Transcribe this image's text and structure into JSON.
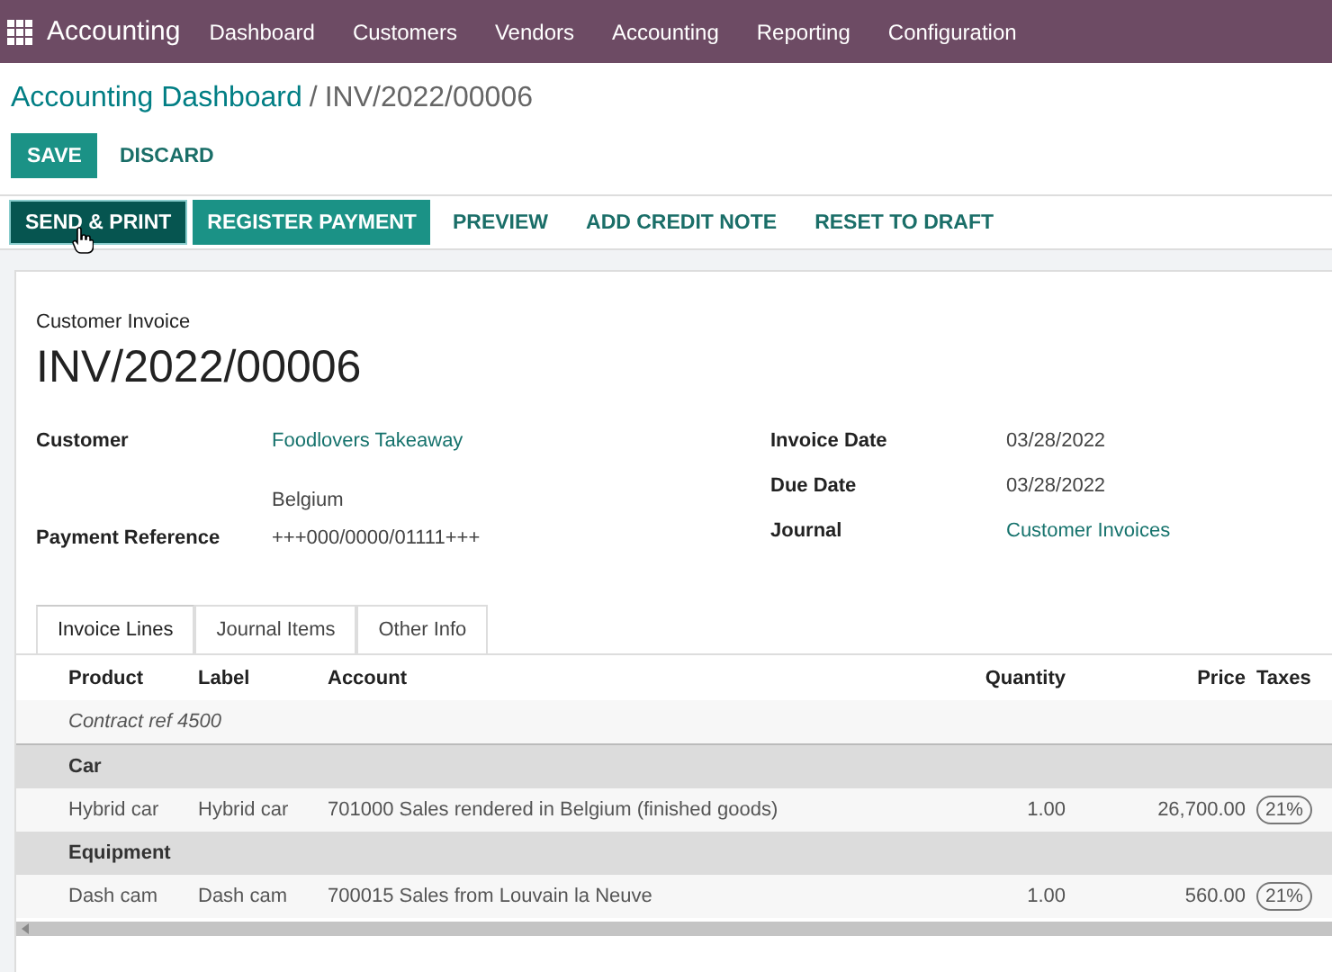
{
  "navbar": {
    "app": "Accounting",
    "menu": [
      "Dashboard",
      "Customers",
      "Vendors",
      "Accounting",
      "Reporting",
      "Configuration"
    ]
  },
  "breadcrumb": {
    "parent": "Accounting Dashboard",
    "separator": "/",
    "current": "INV/2022/00006"
  },
  "edit_buttons": [
    {
      "label": "SAVE",
      "kind": "primary"
    },
    {
      "label": "DISCARD",
      "kind": "link"
    }
  ],
  "actions": [
    {
      "label": "SEND & PRINT",
      "kind": "dark"
    },
    {
      "label": "REGISTER PAYMENT",
      "kind": "primary"
    },
    {
      "label": "PREVIEW",
      "kind": "link"
    },
    {
      "label": "ADD CREDIT NOTE",
      "kind": "link"
    },
    {
      "label": "RESET TO DRAFT",
      "kind": "link"
    }
  ],
  "invoice": {
    "type": "Customer Invoice",
    "number": "INV/2022/00006"
  },
  "left_fields": [
    {
      "label": "Customer",
      "value": "Foodlovers Takeaway",
      "link": true,
      "extra": "Belgium"
    },
    {
      "label": "Payment Reference",
      "value": "+++000/0000/01111+++",
      "link": false
    }
  ],
  "right_fields": [
    {
      "label": "Invoice Date",
      "value": "03/28/2022",
      "link": false
    },
    {
      "label": "Due Date",
      "value": "03/28/2022",
      "link": false
    },
    {
      "label": "Journal",
      "value": "Customer Invoices",
      "link": true
    }
  ],
  "tabs": [
    {
      "label": "Invoice Lines",
      "selected": true
    },
    {
      "label": "Journal Items",
      "selected": false
    },
    {
      "label": "Other Info",
      "selected": false
    }
  ],
  "table": {
    "columns": [
      "Product",
      "Label",
      "Account",
      "Quantity",
      "Price",
      "Taxes"
    ],
    "rows": [
      {
        "kind": "note",
        "text": "Contract ref 4500"
      },
      {
        "kind": "section",
        "text": "Car"
      },
      {
        "kind": "line",
        "product": "Hybrid car",
        "label": "Hybrid car",
        "account": "701000 Sales rendered in Belgium (finished goods)",
        "quantity": "1.00",
        "price": "26,700.00",
        "tax": "21%"
      },
      {
        "kind": "section",
        "text": "Equipment"
      },
      {
        "kind": "line",
        "product": "Dash cam",
        "label": "Dash cam",
        "account": "700015 Sales from Louvain la Neuve",
        "quantity": "1.00",
        "price": "560.00",
        "tax": "21%"
      }
    ]
  }
}
